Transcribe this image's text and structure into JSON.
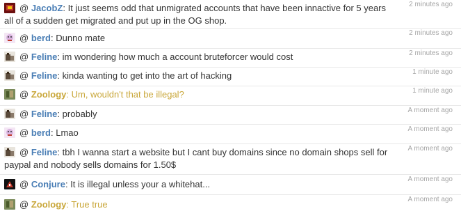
{
  "colors": {
    "username_blue": "#4a7eb5",
    "username_gold": "#c9a73a",
    "timestamp_gray": "#a6a6a6",
    "divider": "#e8e8e8"
  },
  "messages": [
    {
      "avatar": "jacob-avatar-icon",
      "at": "@",
      "user": "JacobZ",
      "user_color": "#4a7eb5",
      "sep": ":",
      "text": " It just seems odd that unmigrated accounts that have been innactive for 5 years all of a sudden get migrated and put up in the OG shop.",
      "text_color": "#333333",
      "time": "2 minutes ago"
    },
    {
      "avatar": "berd-avatar-icon",
      "at": "@",
      "user": "berd",
      "user_color": "#4a7eb5",
      "sep": ":",
      "text": " Dunno mate",
      "text_color": "#333333",
      "time": "2 minutes ago"
    },
    {
      "avatar": "feline-avatar-icon",
      "at": "@",
      "user": "Feline",
      "user_color": "#4a7eb5",
      "sep": ":",
      "text": " im wondering how much a account bruteforcer would cost",
      "text_color": "#333333",
      "time": "2 minutes ago"
    },
    {
      "avatar": "feline-avatar-icon",
      "at": "@",
      "user": "Feline",
      "user_color": "#4a7eb5",
      "sep": ":",
      "text": " kinda wanting to get into the art of hacking",
      "text_color": "#333333",
      "time": "1 minute ago"
    },
    {
      "avatar": "zoology-avatar-icon",
      "at": "@",
      "user": "Zoology",
      "user_color": "#c9a73a",
      "sep": ":",
      "text": " Um, wouldn't that be illegal?",
      "text_color": "#c9a73a",
      "time": "1 minute ago"
    },
    {
      "avatar": "feline-avatar-icon",
      "at": "@",
      "user": "Feline",
      "user_color": "#4a7eb5",
      "sep": ":",
      "text": " probably",
      "text_color": "#333333",
      "time": "A moment ago"
    },
    {
      "avatar": "berd-avatar-icon",
      "at": "@",
      "user": "berd",
      "user_color": "#4a7eb5",
      "sep": ":",
      "text": " Lmao",
      "text_color": "#333333",
      "time": "A moment ago"
    },
    {
      "avatar": "feline-avatar-icon",
      "at": "@",
      "user": "Feline",
      "user_color": "#4a7eb5",
      "sep": ":",
      "text": " tbh I wanna start a website but I cant buy domains since no domain shops sell for paypal and nobody sells domains for 1.50$",
      "text_color": "#333333",
      "time": "A moment ago"
    },
    {
      "avatar": "conjure-avatar-icon",
      "at": "@",
      "user": "Conjure",
      "user_color": "#4a7eb5",
      "sep": ":",
      "text": " It is illegal unless your a whitehat...",
      "text_color": "#333333",
      "time": "A moment ago"
    },
    {
      "avatar": "zoology-avatar-icon",
      "at": "@",
      "user": "Zoology",
      "user_color": "#c9a73a",
      "sep": ":",
      "text": " True true",
      "text_color": "#c9a73a",
      "time": "A moment ago"
    }
  ]
}
